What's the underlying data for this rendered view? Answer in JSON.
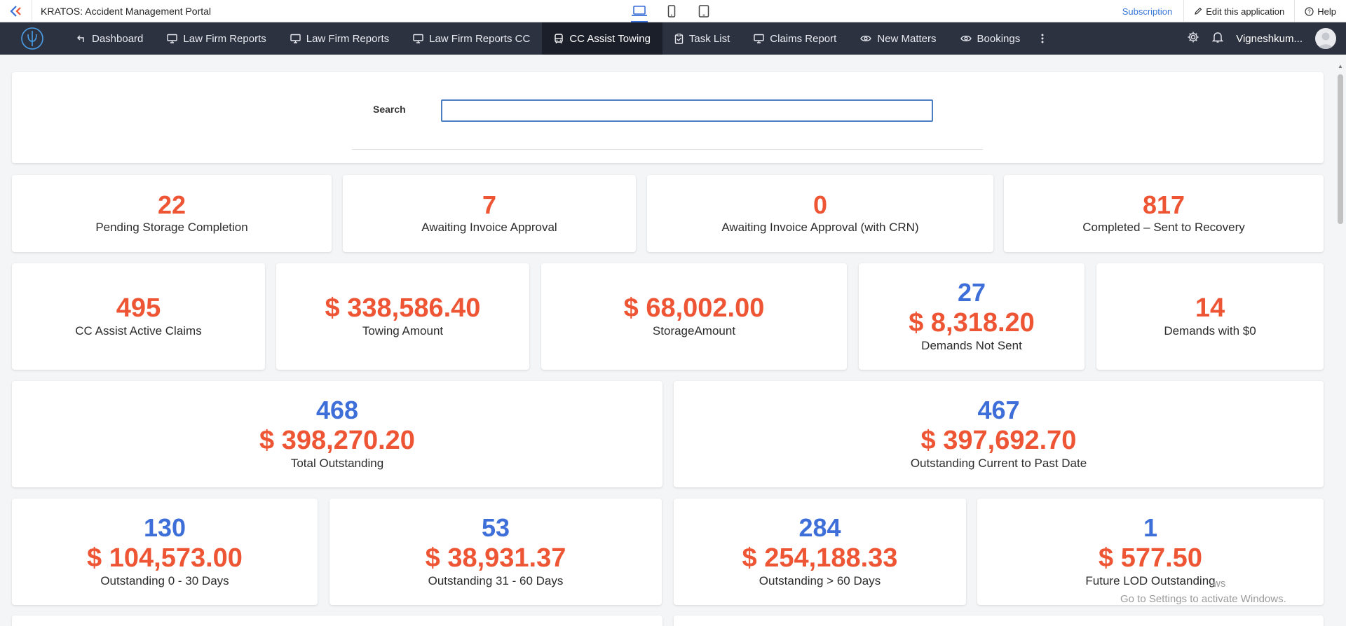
{
  "app": {
    "title": "KRATOS: Accident Management Portal"
  },
  "topbar": {
    "subscription": "Subscription",
    "edit": "Edit this application",
    "help": "Help"
  },
  "nav": {
    "tabs": [
      {
        "label": "Dashboard",
        "icon": "return-icon"
      },
      {
        "label": "Law Firm Reports",
        "icon": "monitor-icon"
      },
      {
        "label": "Law Firm Reports",
        "icon": "monitor-icon"
      },
      {
        "label": "Law Firm Reports CC",
        "icon": "monitor-icon"
      },
      {
        "label": "CC Assist Towing",
        "icon": "bus-icon"
      },
      {
        "label": "Task List",
        "icon": "clipboard-icon"
      },
      {
        "label": "Claims Report",
        "icon": "monitor-icon"
      },
      {
        "label": "New Matters",
        "icon": "eye-icon"
      },
      {
        "label": "Bookings",
        "icon": "eye-icon"
      }
    ],
    "user": "Vigneshkum..."
  },
  "search": {
    "label": "Search",
    "value": ""
  },
  "stats": {
    "row1": [
      {
        "count": "22",
        "label": "Pending Storage Completion"
      },
      {
        "count": "7",
        "label": "Awaiting Invoice Approval"
      },
      {
        "count": "0",
        "label": "Awaiting Invoice Approval (with CRN)"
      },
      {
        "count": "817",
        "label": "Completed – Sent to Recovery"
      }
    ],
    "row2": [
      {
        "value": "495",
        "label": "CC Assist Active Claims"
      },
      {
        "value": "$ 338,586.40",
        "label": "Towing Amount"
      },
      {
        "value": "$ 68,002.00",
        "label": "StorageAmount"
      },
      {
        "count": "27",
        "value": "$ 8,318.20",
        "label": "Demands Not Sent"
      },
      {
        "value": "14",
        "label": "Demands with $0"
      }
    ],
    "row3": [
      {
        "count": "468",
        "value": "$ 398,270.20",
        "label": "Total Outstanding"
      },
      {
        "count": "467",
        "value": "$ 397,692.70",
        "label": "Outstanding Current to Past Date"
      }
    ],
    "row4": [
      {
        "count": "130",
        "value": "$ 104,573.00",
        "label": "Outstanding 0 - 30 Days"
      },
      {
        "count": "53",
        "value": "$ 38,931.37",
        "label": "Outstanding 31 - 60 Days"
      },
      {
        "count": "284",
        "value": "$ 254,188.33",
        "label": "Outstanding > 60 Days"
      },
      {
        "count": "1",
        "value": "$ 577.50",
        "label": "Future LOD Outstanding"
      }
    ]
  },
  "watermark": {
    "line1": "ws",
    "line2": "Go to Settings to activate Windows."
  },
  "colors": {
    "nav_bg": "#2d3241",
    "active_tab": "#1b1f2a",
    "count_red": "#ee5534",
    "count_blue": "#3e6fd9",
    "accent": "#3a78d8"
  }
}
